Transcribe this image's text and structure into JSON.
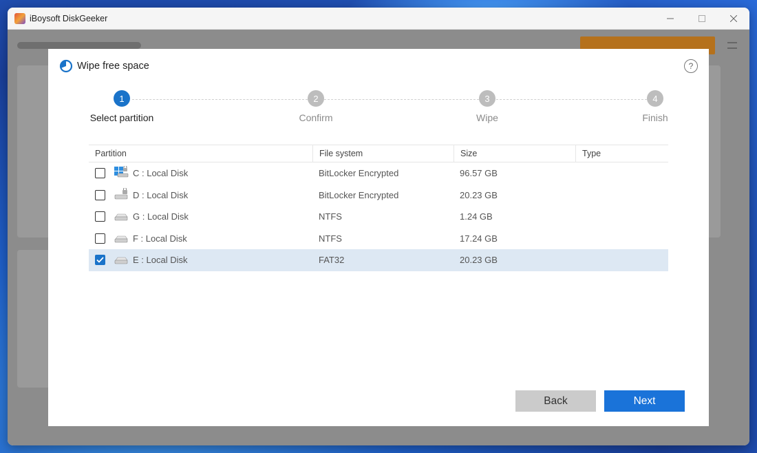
{
  "window": {
    "title": "iBoysoft DiskGeeker"
  },
  "dialog": {
    "title": "Wipe free space",
    "help": "?"
  },
  "steps": [
    {
      "number": "1",
      "label": "Select partition"
    },
    {
      "number": "2",
      "label": "Confirm"
    },
    {
      "number": "3",
      "label": "Wipe"
    },
    {
      "number": "4",
      "label": "Finish"
    }
  ],
  "active_step": 1,
  "table": {
    "columns": [
      "Partition",
      "File system",
      "Size",
      "Type"
    ],
    "rows": [
      {
        "partition": "C : Local Disk",
        "fs": "BitLocker Encrypted",
        "size": "96.57 GB",
        "type": "",
        "checked": false,
        "icon": "windows-locked-disk-icon"
      },
      {
        "partition": "D : Local Disk",
        "fs": "BitLocker Encrypted",
        "size": "20.23 GB",
        "type": "",
        "checked": false,
        "icon": "locked-disk-icon"
      },
      {
        "partition": "G : Local Disk",
        "fs": "NTFS",
        "size": "1.24 GB",
        "type": "",
        "checked": false,
        "icon": "disk-icon"
      },
      {
        "partition": "F : Local Disk",
        "fs": "NTFS",
        "size": "17.24 GB",
        "type": "",
        "checked": false,
        "icon": "disk-icon"
      },
      {
        "partition": "E : Local Disk",
        "fs": "FAT32",
        "size": "20.23 GB",
        "type": "",
        "checked": true,
        "icon": "disk-icon"
      }
    ]
  },
  "buttons": {
    "back": "Back",
    "next": "Next"
  },
  "colors": {
    "accent": "#1a73c9",
    "selected_row": "#dde8f3"
  }
}
